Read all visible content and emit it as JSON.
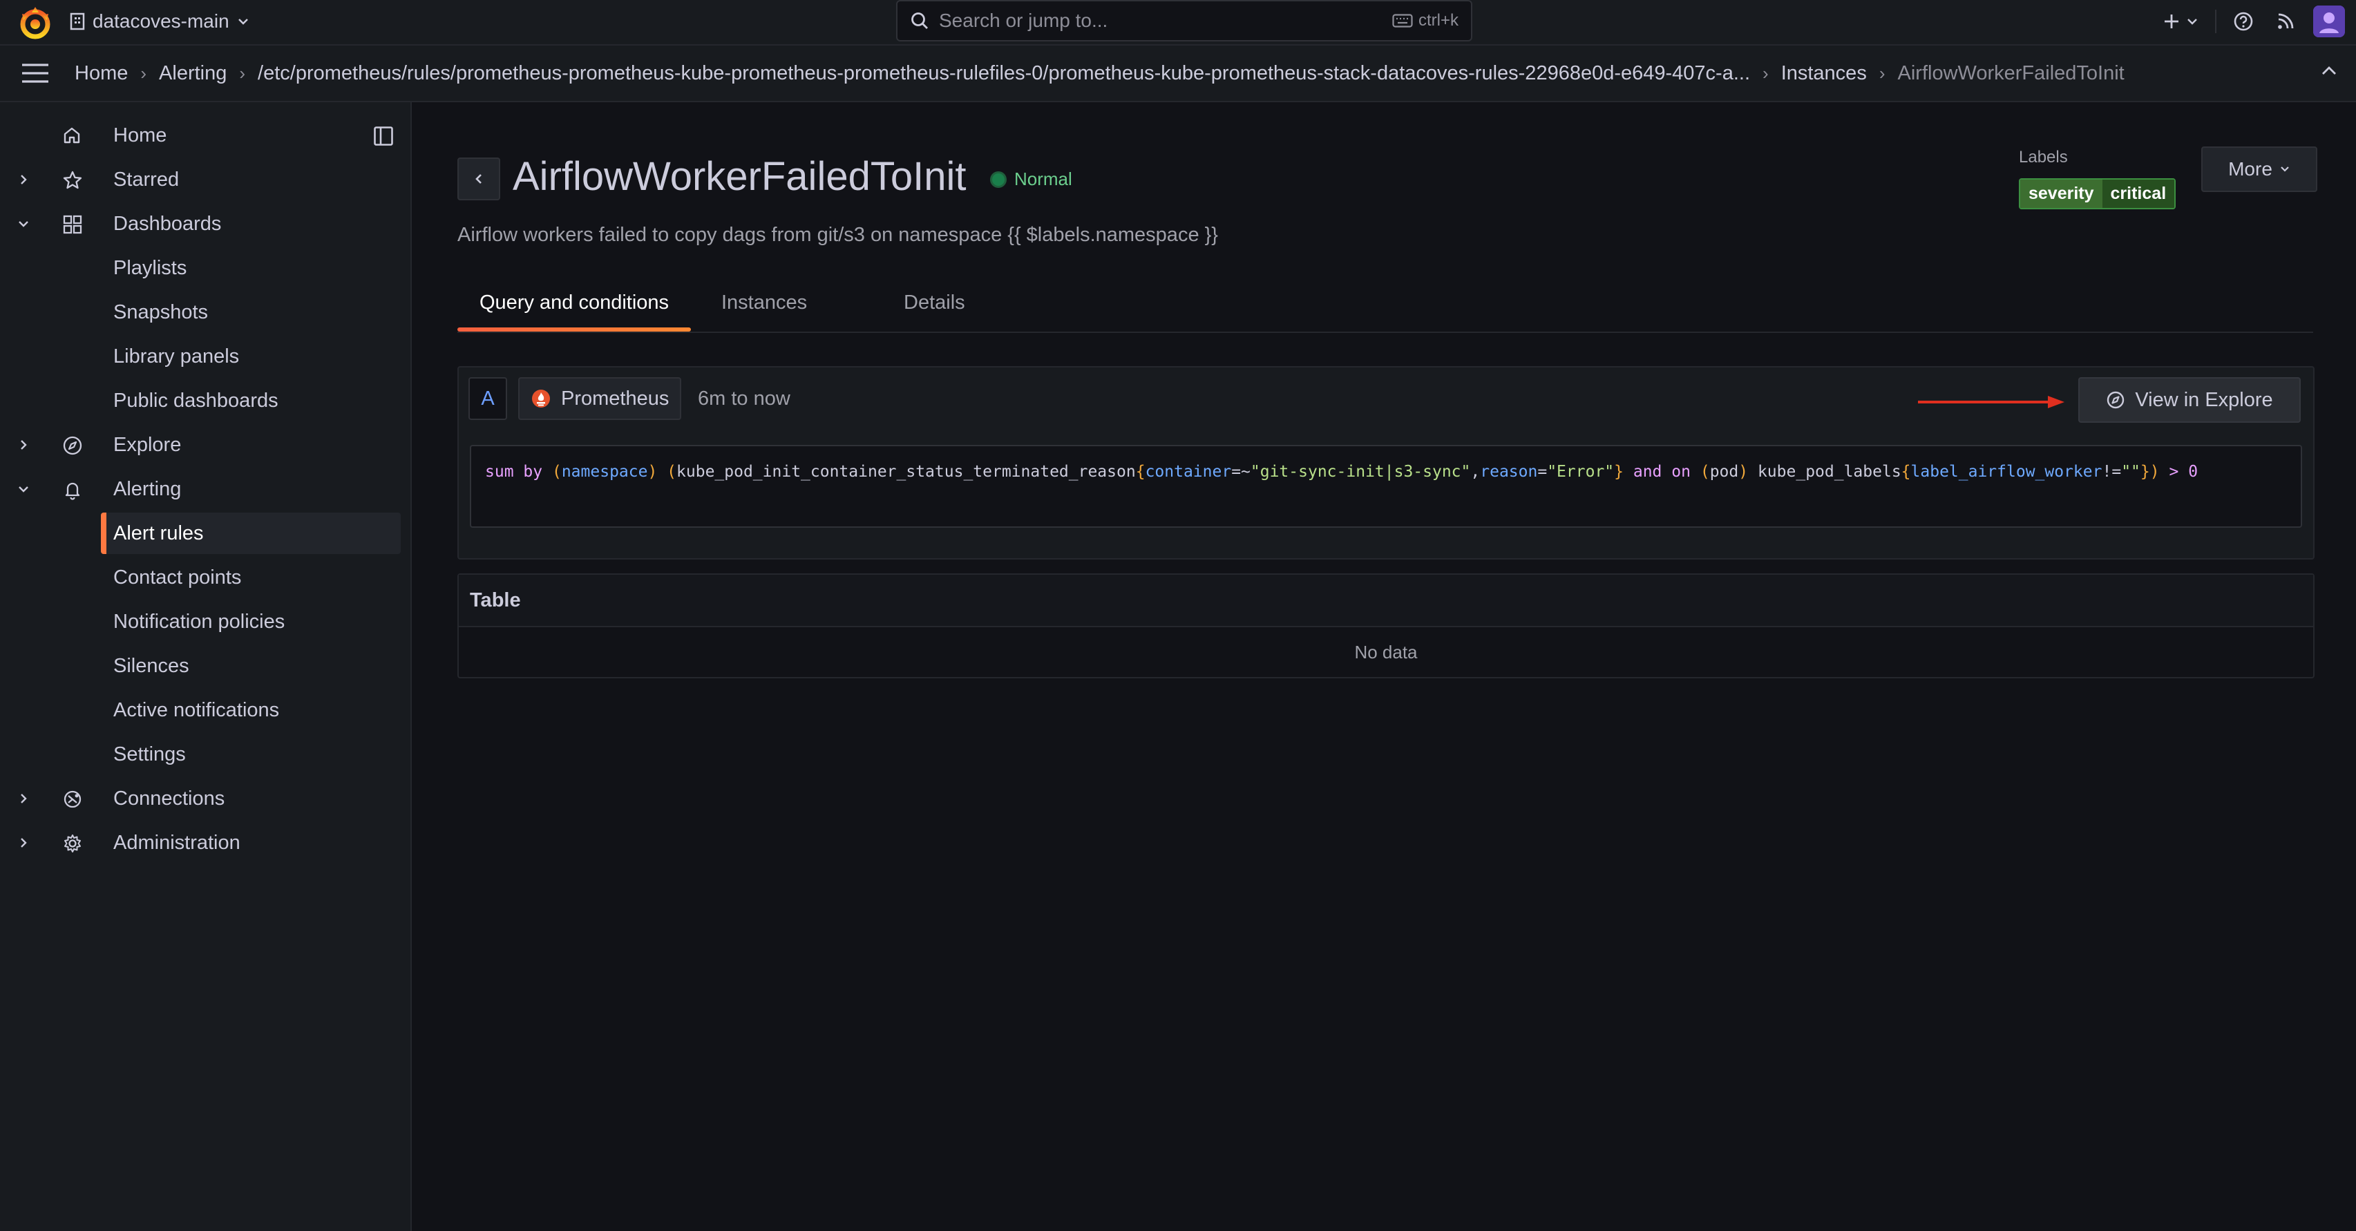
{
  "topbar": {
    "org_name": "datacoves-main",
    "search_placeholder": "Search or jump to...",
    "search_shortcut": "ctrl+k"
  },
  "breadcrumbs": [
    "Home",
    "Alerting",
    "/etc/prometheus/rules/prometheus-prometheus-kube-prometheus-prometheus-rulefiles-0/prometheus-kube-prometheus-stack-datacoves-rules-22968e0d-e649-407c-a...",
    "Instances",
    "AirflowWorkerFailedToInit"
  ],
  "sidebar": {
    "items": [
      {
        "label": "Home",
        "icon": "home-icon"
      },
      {
        "label": "Starred",
        "icon": "star-icon"
      },
      {
        "label": "Dashboards",
        "icon": "dashboards-icon"
      },
      {
        "label": "Playlists"
      },
      {
        "label": "Snapshots"
      },
      {
        "label": "Library panels"
      },
      {
        "label": "Public dashboards"
      },
      {
        "label": "Explore",
        "icon": "compass-icon"
      },
      {
        "label": "Alerting",
        "icon": "bell-icon"
      },
      {
        "label": "Alert rules",
        "active": true
      },
      {
        "label": "Contact points"
      },
      {
        "label": "Notification policies"
      },
      {
        "label": "Silences"
      },
      {
        "label": "Active notifications"
      },
      {
        "label": "Settings"
      },
      {
        "label": "Connections",
        "icon": "connections-icon"
      },
      {
        "label": "Administration",
        "icon": "gear-icon"
      }
    ]
  },
  "rule": {
    "title": "AirflowWorkerFailedToInit",
    "state": "Normal",
    "summary": "Airflow workers failed to copy dags from git/s3 on namespace {{ $labels.namespace }}",
    "labels_caption": "Labels",
    "label_key": "severity",
    "label_value": "critical",
    "more_label": "More"
  },
  "tabs": [
    "Query and conditions",
    "Instances",
    "Details"
  ],
  "query": {
    "ref_id": "A",
    "datasource": "Prometheus",
    "time_range": "6m to now",
    "explore_label": "View in Explore",
    "tokens": [
      {
        "t": "sum",
        "c": "kw"
      },
      {
        "t": " "
      },
      {
        "t": "by",
        "c": "kw"
      },
      {
        "t": " "
      },
      {
        "t": "(",
        "c": "pn"
      },
      {
        "t": "namespace",
        "c": "lbl"
      },
      {
        "t": ")",
        "c": "pn"
      },
      {
        "t": " "
      },
      {
        "t": "(",
        "c": "pn"
      },
      {
        "t": "kube_pod_init_container_status_terminated_reason",
        "c": "id"
      },
      {
        "t": "{",
        "c": "pn"
      },
      {
        "t": "container",
        "c": "lbl"
      },
      {
        "t": "=~",
        "c": "id"
      },
      {
        "t": "\"git-sync-init|s3-sync\"",
        "c": "str"
      },
      {
        "t": ",",
        "c": "id"
      },
      {
        "t": "reason",
        "c": "lbl"
      },
      {
        "t": "=",
        "c": "id"
      },
      {
        "t": "\"Error\"",
        "c": "str"
      },
      {
        "t": "}",
        "c": "pn"
      },
      {
        "t": " "
      },
      {
        "t": "and",
        "c": "kw"
      },
      {
        "t": " "
      },
      {
        "t": "on",
        "c": "kw"
      },
      {
        "t": " "
      },
      {
        "t": "(",
        "c": "pn"
      },
      {
        "t": "pod",
        "c": "id"
      },
      {
        "t": ")",
        "c": "pn"
      },
      {
        "t": " "
      },
      {
        "t": "kube_pod_labels",
        "c": "id"
      },
      {
        "t": "{",
        "c": "pn"
      },
      {
        "t": "label_airflow_worker",
        "c": "lbl"
      },
      {
        "t": "!=",
        "c": "id"
      },
      {
        "t": "\"\"",
        "c": "str"
      },
      {
        "t": "}",
        "c": "pn"
      },
      {
        "t": ")",
        "c": "pn"
      },
      {
        "t": " "
      },
      {
        "t": ">",
        "c": "op"
      },
      {
        "t": " "
      },
      {
        "t": "0",
        "c": "op"
      }
    ]
  },
  "table": {
    "title": "Table",
    "empty_text": "No data"
  },
  "colors": {
    "accent": "#ff7941",
    "state_ok": "#6ccf8e",
    "label_chip": "#3c6e30",
    "annotation_arrow": "#e02f1f"
  }
}
